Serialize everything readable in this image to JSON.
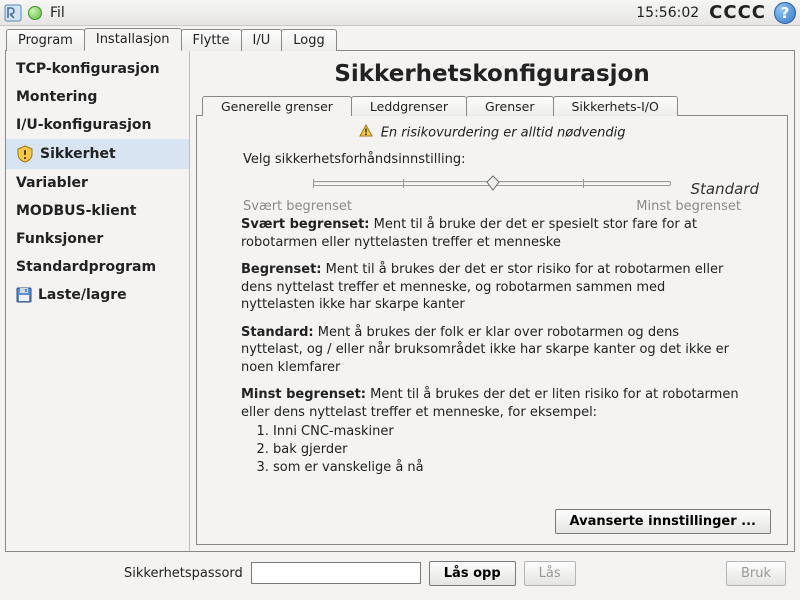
{
  "menubar": {
    "file_label": "Fil",
    "clock": "15:56:02",
    "status": "CCCC",
    "help_glyph": "?"
  },
  "tabs": {
    "items": [
      "Program",
      "Installasjon",
      "Flytte",
      "I/U",
      "Logg"
    ],
    "active_index": 1
  },
  "sidebar": {
    "items": [
      {
        "label": "TCP-konfigurasjon"
      },
      {
        "label": "Montering"
      },
      {
        "label": "I/U-konfigurasjon"
      },
      {
        "label": "Sikkerhet",
        "icon": "shield"
      },
      {
        "label": "Variabler"
      },
      {
        "label": "MODBUS-klient"
      },
      {
        "label": "Funksjoner"
      },
      {
        "label": "Standardprogram"
      },
      {
        "label": "Laste/lagre",
        "icon": "disk"
      }
    ],
    "selected_index": 3
  },
  "main": {
    "title": "Sikkerhetskonfigurasjon",
    "subtabs": {
      "items": [
        "Generelle grenser",
        "Leddgrenser",
        "Grenser",
        "Sikkerhets-I/O"
      ],
      "active_index": 0
    },
    "risk_notice": "En risikovurdering er alltid nødvendig",
    "preset_prompt": "Velg sikkerhetsforhåndsinnstilling:",
    "slider": {
      "left_label": "Svært begrenset",
      "right_label": "Minst begrenset",
      "steps": 4,
      "value_index": 2
    },
    "current_preset": "Standard",
    "descriptions": {
      "very_restricted": {
        "title": "Svært begrenset:",
        "text": "Ment til å bruke der det er spesielt stor fare for at robotarmen eller nyttelasten treffer et menneske"
      },
      "restricted": {
        "title": "Begrenset:",
        "text": "Ment til å brukes der det er stor risiko for at robotarmen eller dens nyttelast treffer et menneske, og robotarmen sammen med nyttelasten ikke har skarpe kanter"
      },
      "standard": {
        "title": "Standard:",
        "text": "Ment å brukes der folk er klar over robotarmen og dens nyttelast, og / eller når bruksområdet ikke har skarpe kanter og det ikke er noen klemfarer"
      },
      "least_restricted": {
        "title": "Minst begrenset:",
        "text": "Ment til å brukes der det er liten risiko for at robotarmen eller dens nyttelast treffer et menneske, for eksempel:",
        "list": [
          "Inni CNC-maskiner",
          "bak gjerder",
          "som er vanskelige å nå"
        ]
      }
    },
    "advanced_button": "Avanserte innstillinger ..."
  },
  "footer": {
    "password_label": "Sikkerhetspassord",
    "password_value": "",
    "unlock_button": "Lås opp",
    "lock_button": "Lås",
    "apply_button": "Bruk"
  }
}
